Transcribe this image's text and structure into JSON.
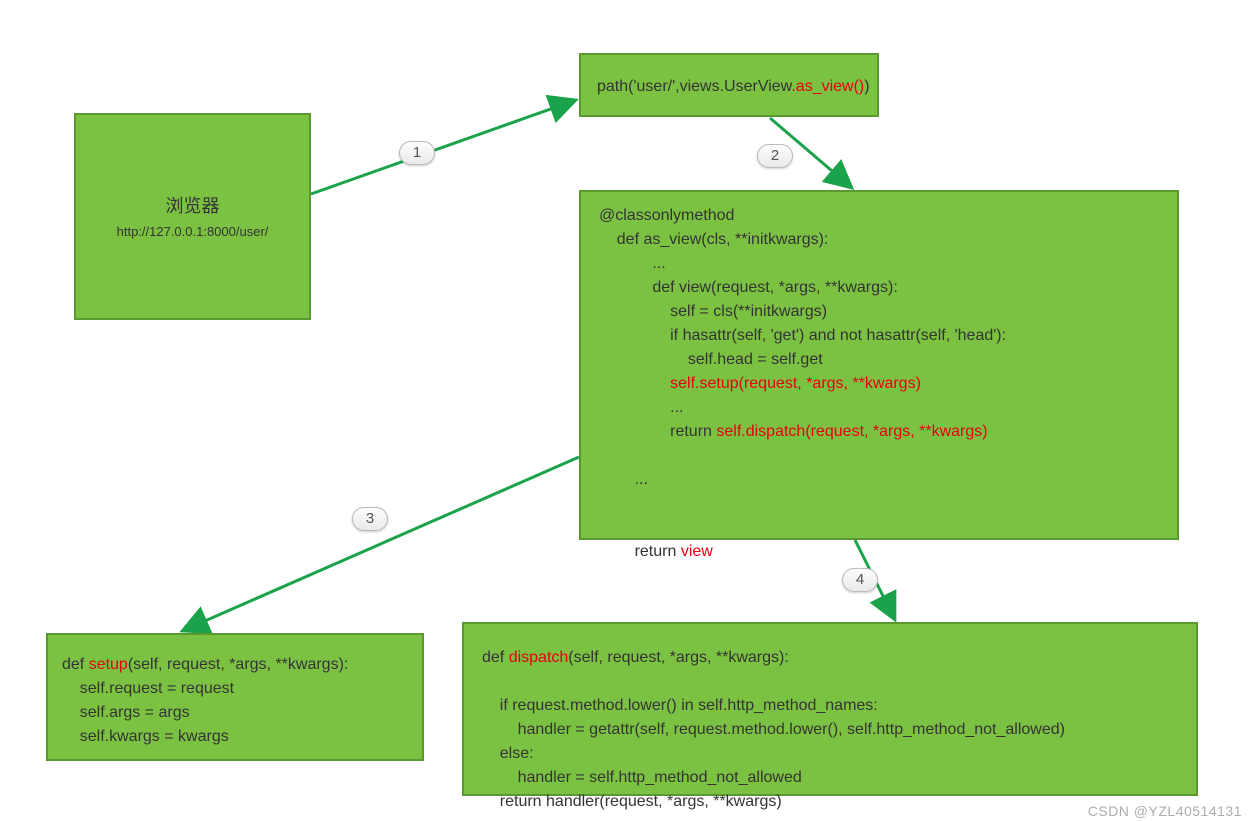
{
  "colors": {
    "box_fill": "#7cc242",
    "box_border": "#5a9930",
    "arrow": "#1aa34a",
    "highlight": "#e60012"
  },
  "badges": {
    "b1": "1",
    "b2": "2",
    "b3": "3",
    "b4": "4"
  },
  "browser": {
    "title": "浏览器",
    "url": "http://127.0.0.1:8000/user/"
  },
  "path": {
    "prefix": "path('user/',views.UserView",
    "call": ".as_view()",
    "suffix": ")"
  },
  "asview": {
    "l1": "@classonlymethod",
    "l2": "    def as_view(cls, **initkwargs):",
    "l3": "            ...",
    "l4": "            def view(request, *args, **kwargs):",
    "l5": "                self = cls(**initkwargs)",
    "l6": "                if hasattr(self, 'get') and not hasattr(self, 'head'):",
    "l7": "                    self.head = self.get",
    "l8a": "                ",
    "l8b": "self.setup(request, *args, **kwargs)",
    "l9": "                ...",
    "l10a": "                return ",
    "l10b": "self.dispatch(request, *args, **kwargs)",
    "l11": "",
    "l12": "        ...",
    "l13": "",
    "l14": "",
    "l15a": "        return ",
    "l15b": "view"
  },
  "setup": {
    "l1a": "def ",
    "l1b": "setup",
    "l1c": "(self, request, *args, **kwargs):",
    "l2": "    self.request = request",
    "l3": "    self.args = args",
    "l4": "    self.kwargs = kwargs"
  },
  "dispatch": {
    "l1a": "def ",
    "l1b": "dispatch",
    "l1c": "(self, request, *args, **kwargs):",
    "l2": "",
    "l3": "    if request.method.lower() in self.http_method_names:",
    "l4": "        handler = getattr(self, request.method.lower(), self.http_method_not_allowed)",
    "l5": "    else:",
    "l6": "        handler = self.http_method_not_allowed",
    "l7": "    return handler(request, *args, **kwargs)"
  },
  "watermark": "CSDN @YZL40514131"
}
